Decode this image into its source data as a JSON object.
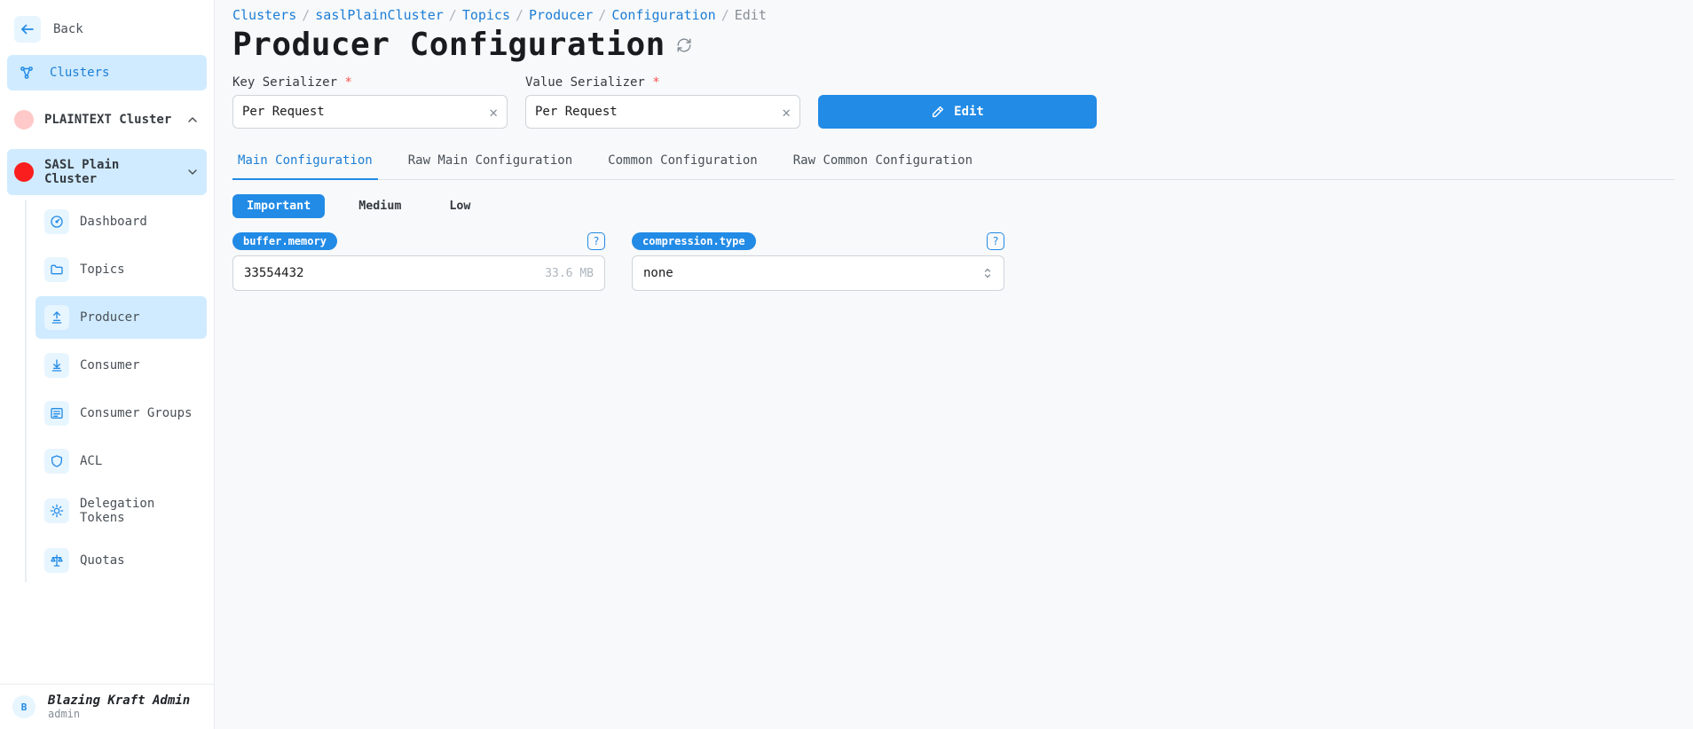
{
  "sidebar": {
    "back_label": "Back",
    "root_label": "Clusters",
    "clusters": [
      {
        "label": "PLAINTEXT Cluster",
        "expanded": false,
        "dot": "pink",
        "active": false
      },
      {
        "label": "SASL Plain Cluster",
        "expanded": true,
        "dot": "red",
        "active": true
      }
    ],
    "items": [
      {
        "label": "Dashboard"
      },
      {
        "label": "Topics"
      },
      {
        "label": "Producer"
      },
      {
        "label": "Consumer"
      },
      {
        "label": "Consumer Groups"
      },
      {
        "label": "ACL"
      },
      {
        "label": "Delegation Tokens"
      },
      {
        "label": "Quotas"
      }
    ],
    "user": {
      "name": "Blazing Kraft Admin",
      "sub": "admin",
      "initial": "B"
    }
  },
  "breadcrumbs": [
    {
      "label": "Clusters",
      "link": true
    },
    {
      "label": "saslPlainCluster",
      "link": true
    },
    {
      "label": "Topics",
      "link": true
    },
    {
      "label": "Producer",
      "link": true
    },
    {
      "label": "Configuration",
      "link": true
    },
    {
      "label": "Edit",
      "link": false
    }
  ],
  "page": {
    "title": "Producer Configuration"
  },
  "form": {
    "key_label": "Key Serializer",
    "value_label": "Value Serializer",
    "key_value": "Per Request",
    "val_value": "Per Request",
    "edit_label": "Edit"
  },
  "tabs": [
    {
      "label": "Main Configuration",
      "active": true
    },
    {
      "label": "Raw Main Configuration",
      "active": false
    },
    {
      "label": "Common Configuration",
      "active": false
    },
    {
      "label": "Raw Common Configuration",
      "active": false
    }
  ],
  "levels": [
    {
      "label": "Important",
      "active": true
    },
    {
      "label": "Medium",
      "active": false
    },
    {
      "label": "Low",
      "active": false
    }
  ],
  "cards": [
    {
      "name": "buffer.memory",
      "value": "33554432",
      "hint": "33.6 MB",
      "type": "text"
    },
    {
      "name": "compression.type",
      "value": "none",
      "hint": "",
      "type": "select"
    }
  ],
  "colors": {
    "primary": "#228be6",
    "primary_light": "#d0ebff",
    "bg": "#f8f9fa"
  }
}
